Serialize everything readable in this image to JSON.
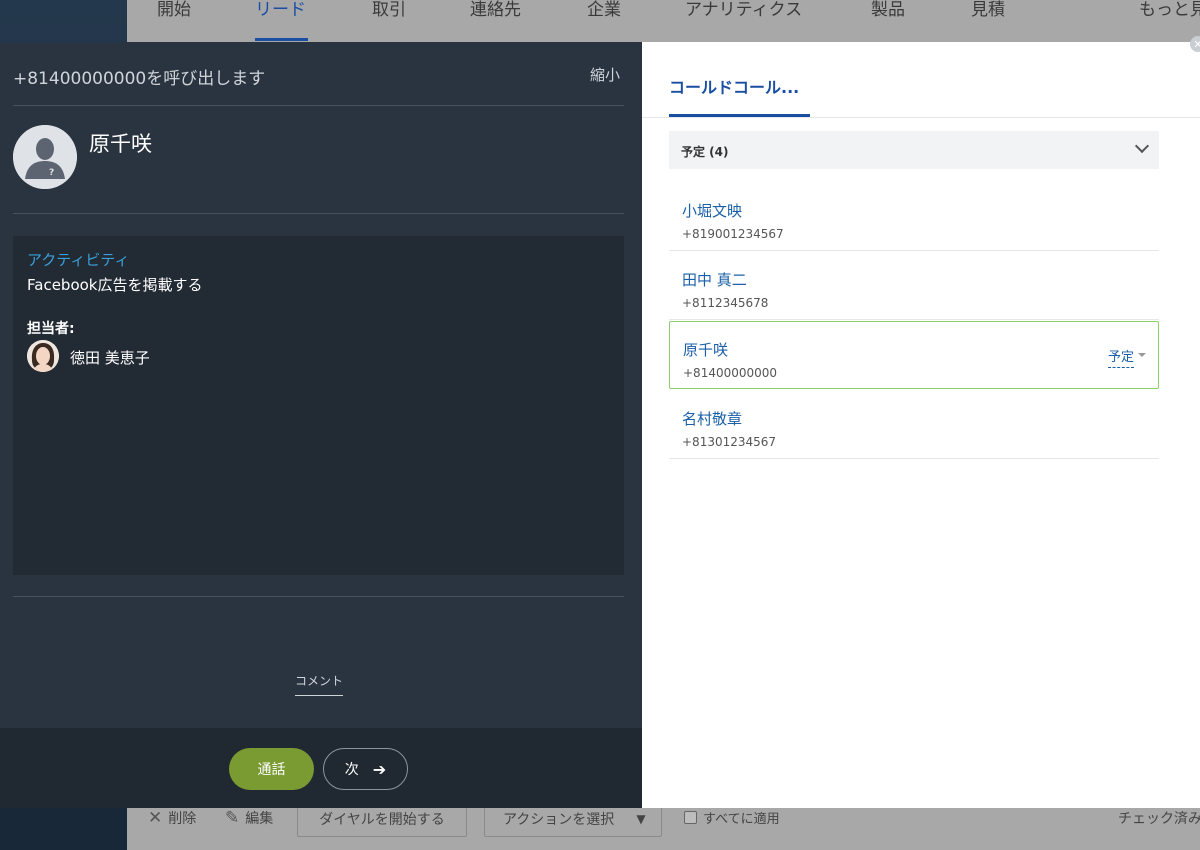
{
  "topnav": {
    "items": [
      "開始",
      "リード",
      "取引",
      "連絡先",
      "企業",
      "アナリティクス",
      "製品",
      "見積",
      "もっと見"
    ],
    "active_index": 1
  },
  "bottombar": {
    "delete_label": "削除",
    "edit_label": "編集",
    "start_dial_label": "ダイヤルを開始する",
    "action_select_label": "アクションを選択",
    "apply_all_label": "すべてに適用",
    "checked_label": "チェック済み:"
  },
  "dialer": {
    "calling_text": "+81400000000を呼び出します",
    "shrink_label": "縮小",
    "contact_name": "原千咲",
    "activity_label": "アクティビティ",
    "activity_text": "Facebook広告を掲載する",
    "owner_label": "担当者:",
    "owner_name": "徳田 美恵子",
    "comment_tab": "コメント",
    "call_button": "通話",
    "next_button": "次"
  },
  "queue": {
    "tab_label": "コールドコール...",
    "group_label": "予定 (4)",
    "items": [
      {
        "name": "小堀文映",
        "phone": "+819001234567"
      },
      {
        "name": "田中 真二",
        "phone": "+8112345678"
      },
      {
        "name": "原千咲",
        "phone": "+81400000000",
        "status": "予定",
        "selected": true
      },
      {
        "name": "名村敬章",
        "phone": "+81301234567"
      }
    ]
  },
  "colors": {
    "accent_blue": "#1a4ea3",
    "call_green": "#7a9a32",
    "selected_border": "#8bd06b",
    "activity_label": "#3aa0d9"
  }
}
